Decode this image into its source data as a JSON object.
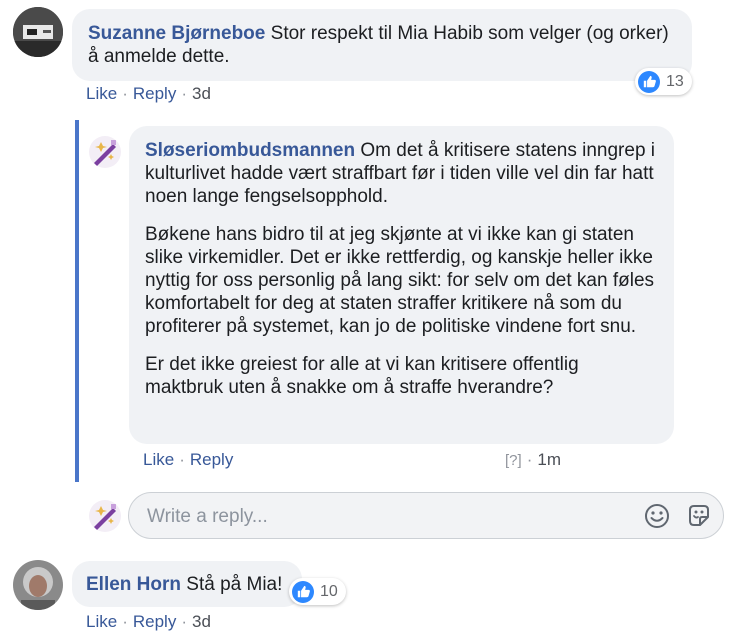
{
  "comments": [
    {
      "author": "Suzanne Bjørneboe",
      "text": "Stor respekt til Mia Habib som velger (og orker) å anmelde dette.",
      "reactions": "13",
      "actions": {
        "like": "Like",
        "reply": "Reply",
        "time": "3d"
      }
    },
    {
      "author": "Sløseriombudsmannen",
      "paragraphs": [
        "Om det å kritisere statens inngrep i kulturlivet hadde vært straffbart før i tiden ville vel din far hatt noen lange fengselsopphold.",
        "Bøkene hans bidro til at jeg skjønte at vi ikke kan gi staten slike virkemidler. Det er ikke rettferdig, og kanskje heller ikke nyttig for oss personlig på lang sikt: for selv om det kan føles komfortabelt for deg at staten straffer kritikere nå som du profiterer på systemet, kan jo de politiske vindene fort snu.",
        "Er det ikke greiest for alle at vi kan kritisere offentlig maktbruk uten å snakke om å straffe hverandre?"
      ],
      "actions": {
        "like": "Like",
        "reply": "Reply",
        "badge": "[?]",
        "time": "1m"
      }
    },
    {
      "author": "Ellen Horn",
      "text": "Stå på Mia!",
      "reactions": "10",
      "actions": {
        "like": "Like",
        "reply": "Reply",
        "time": "3d"
      }
    }
  ],
  "reply_box": {
    "placeholder": "Write a reply..."
  },
  "icons": {
    "reaction": "like-icon",
    "emoji": "smiley-icon",
    "sticker": "sticker-icon"
  },
  "colors": {
    "link": "#385898",
    "bubble": "#f0f2f5",
    "like": "#2d88ff",
    "thread_line": "#4a76c9"
  }
}
